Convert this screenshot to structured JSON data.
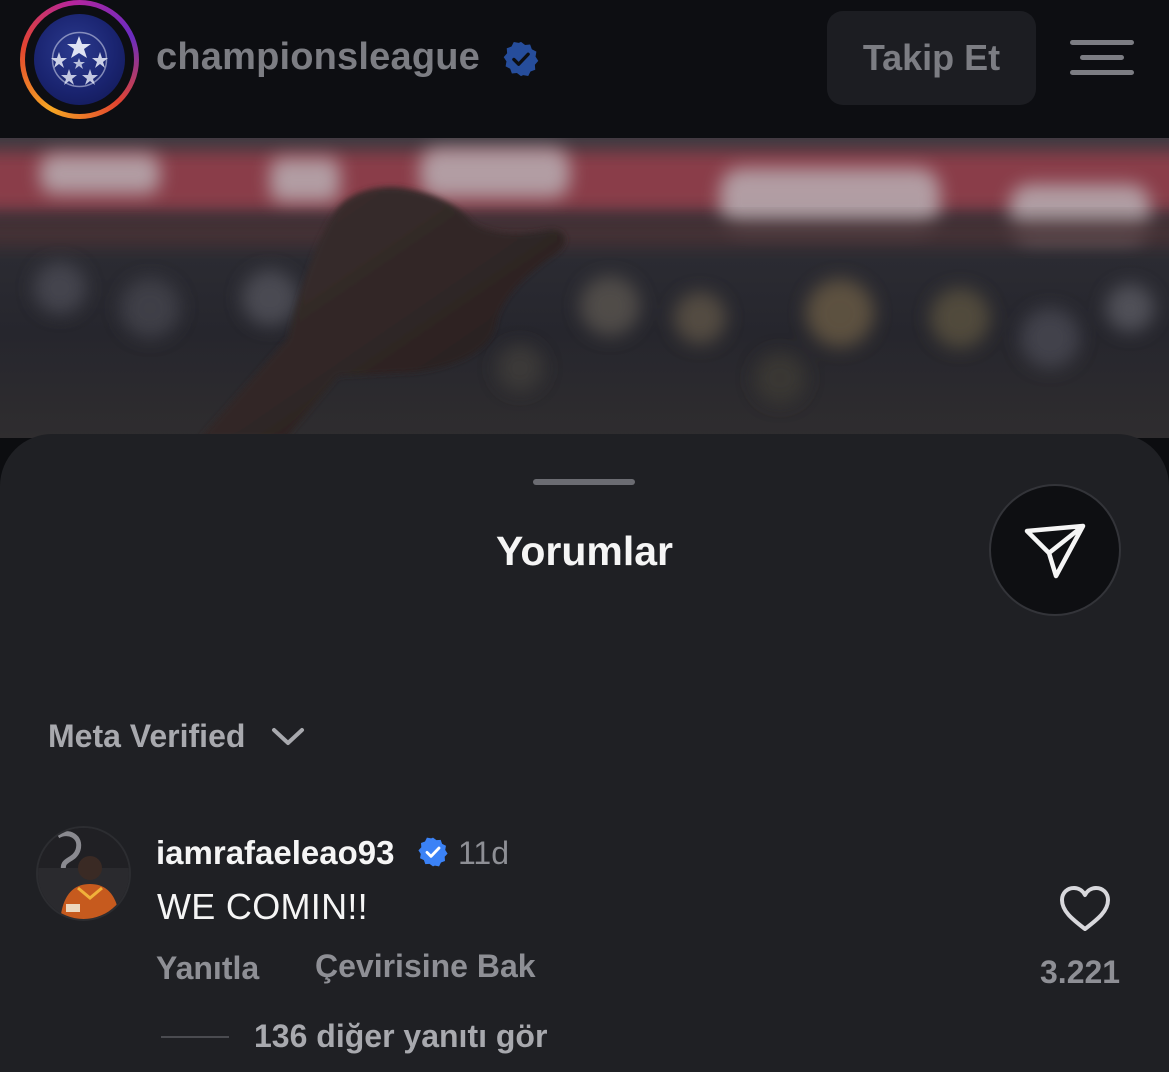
{
  "header": {
    "account_name": "championsleague",
    "follow_label": "Takip Et",
    "icons": {
      "avatar": "uefa-starball-logo",
      "verified": "verified-badge-icon",
      "menu": "hamburger-menu-icon"
    }
  },
  "sheet": {
    "title": "Yorumlar",
    "share_icon": "paper-plane-icon",
    "filter_label": "Meta Verified",
    "filter_icon": "chevron-down-icon"
  },
  "comment": {
    "username": "iamrafaeleao93",
    "time": "11d",
    "text": "WE COMIN!!",
    "reply_label": "Yanıtla",
    "translate_label": "Çevirisine Bak",
    "like_count": "3.221",
    "view_replies": "136 diğer yanıtı gör",
    "icons": {
      "verified": "verified-badge-icon",
      "like": "heart-outline-icon"
    }
  },
  "colors": {
    "background": "#0c0d10",
    "sheet": "#1f2024",
    "muted_text": "#8e8f95",
    "verified_blue": "#3b82f6",
    "follow_button_bg": "#1c1d22"
  }
}
